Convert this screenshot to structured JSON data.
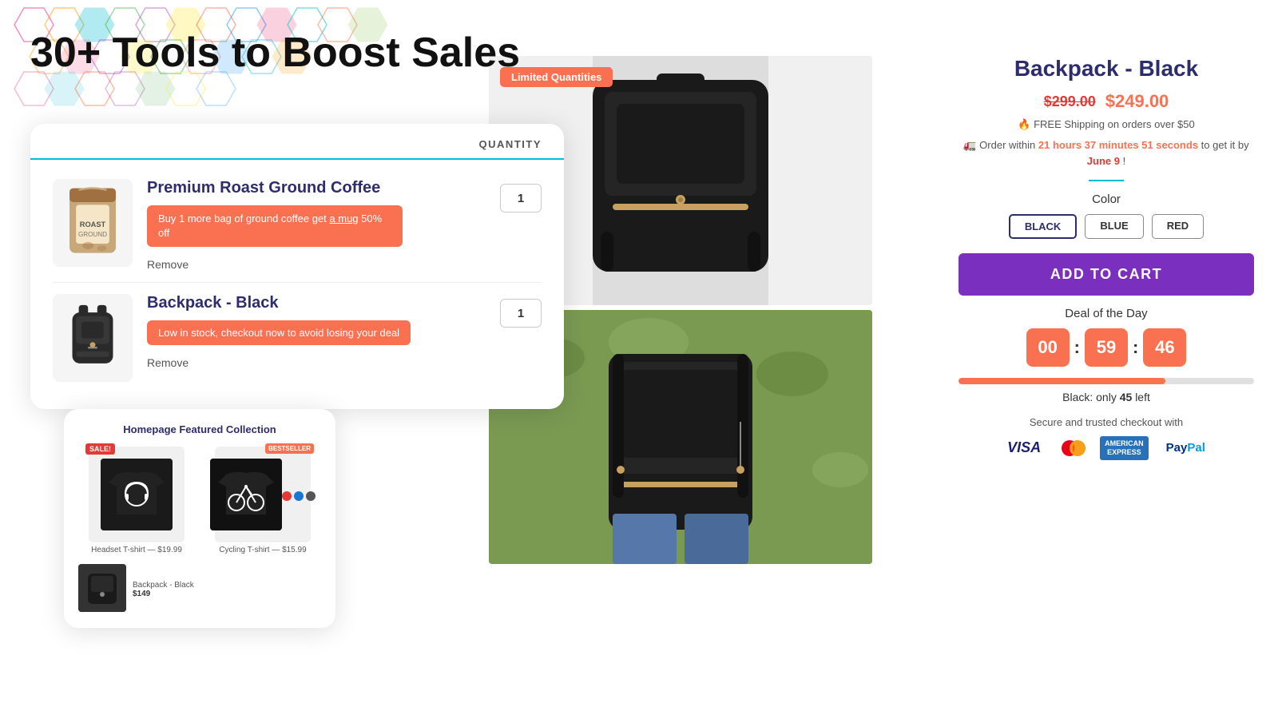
{
  "hero": {
    "title": "30+ Tools to Boost Sales"
  },
  "cart": {
    "header_label": "QUANTITY",
    "items": [
      {
        "name": "Premium Roast Ground Coffee",
        "promo": "Buy 1 more bag of ground coffee get a mug 50% off",
        "promo_link": "a mug",
        "qty": "1",
        "remove_label": "Remove"
      },
      {
        "name": "Backpack - Black",
        "promo_low": "Low in stock, checkout now to avoid losing your deal",
        "qty": "1",
        "remove_label": "Remove"
      }
    ]
  },
  "featured": {
    "title": "Homepage Featured Collection",
    "items": [
      {
        "name": "Headset T-shirt",
        "price": "$19.99",
        "has_sale_badge": true,
        "sale_label": "SALE!"
      },
      {
        "name": "Cycling T-shirt",
        "price": "$15.99",
        "has_bestseller_badge": true,
        "bestseller_label": "BESTSELLER",
        "color_swatches": [
          "#e53935",
          "#1976d2",
          "#555"
        ]
      },
      {
        "name": "Backpack - Black",
        "price": "$149",
        "colspan": 2
      }
    ]
  },
  "product": {
    "limited_badge": "Limited Quantities",
    "title": "Backpack - Black",
    "price_original": "$299.00",
    "price_sale": "$249.00",
    "shipping": "FREE Shipping on orders over $50",
    "order_urgency_prefix": "Order within",
    "order_urgency_time": "21 hours 37 minutes 51 seconds",
    "order_urgency_suffix": "to get it by",
    "order_urgency_date": "June 9",
    "order_urgency_end": "!",
    "color_label": "Color",
    "colors": [
      "BLACK",
      "BLUE",
      "RED"
    ],
    "selected_color": "BLACK",
    "add_to_cart_label": "ADD TO CART",
    "deal_label": "Deal of the Day",
    "countdown": {
      "hours": "00",
      "minutes": "59",
      "seconds": "46"
    },
    "stock_percent": 70,
    "stock_text_prefix": "Black: only",
    "stock_count": "45",
    "stock_text_suffix": "left",
    "secure_label": "Secure and trusted checkout with",
    "payment_methods": [
      "VISA",
      "Mastercard",
      "AMEX",
      "PayPal"
    ]
  }
}
